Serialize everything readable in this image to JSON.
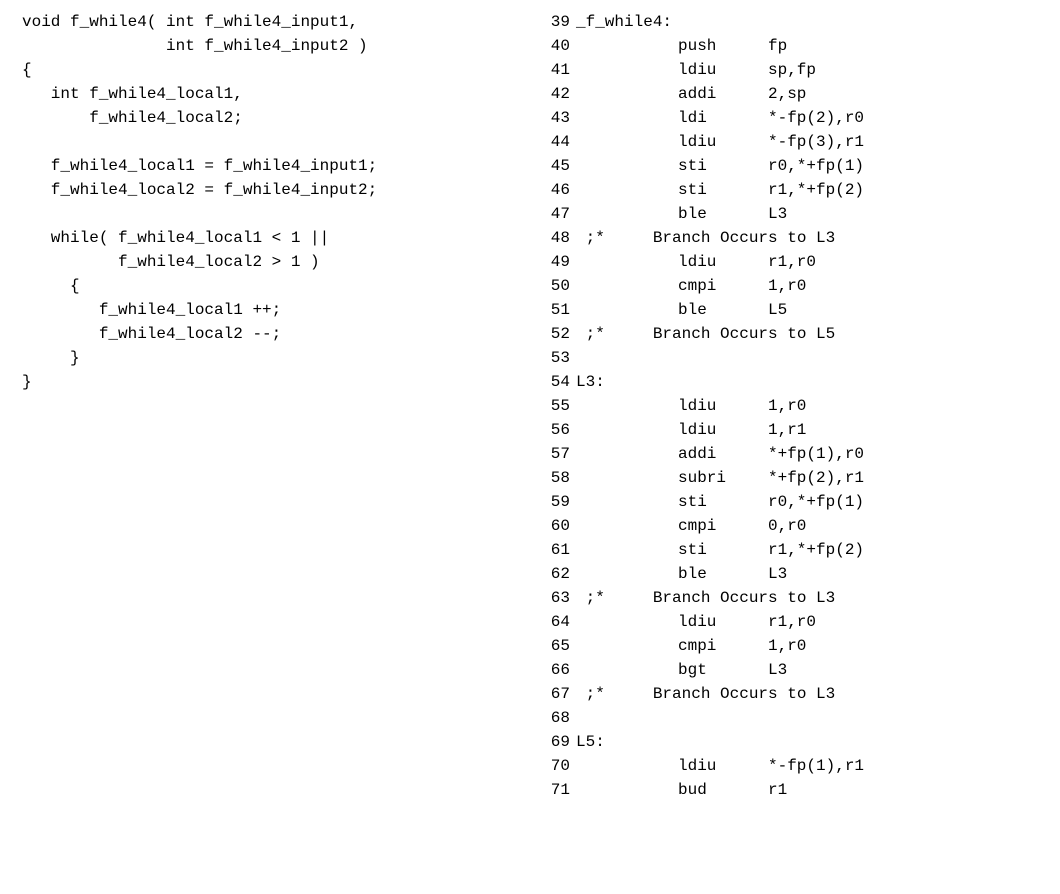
{
  "c_code": [
    "void f_while4( int f_while4_input1,",
    "               int f_while4_input2 )",
    "{",
    "   int f_while4_local1,",
    "       f_while4_local2;",
    "",
    "   f_while4_local1 = f_while4_input1;",
    "   f_while4_local2 = f_while4_input2;",
    "",
    "   while( f_while4_local1 < 1 ||",
    "          f_while4_local2 > 1 )",
    "     {",
    "        f_while4_local1 ++;",
    "        f_while4_local2 --;",
    "     }",
    "}"
  ],
  "asm": [
    {
      "n": "39",
      "label": "_f_while4:",
      "op": "",
      "arg": ""
    },
    {
      "n": "40",
      "label": "",
      "op": "push",
      "arg": "fp"
    },
    {
      "n": "41",
      "label": "",
      "op": "ldiu",
      "arg": "sp,fp"
    },
    {
      "n": "42",
      "label": "",
      "op": "addi",
      "arg": "2,sp"
    },
    {
      "n": "43",
      "label": "",
      "op": "ldi",
      "arg": "*-fp(2),r0"
    },
    {
      "n": "44",
      "label": "",
      "op": "ldiu",
      "arg": "*-fp(3),r1"
    },
    {
      "n": "45",
      "label": "",
      "op": "sti",
      "arg": "r0,*+fp(1)"
    },
    {
      "n": "46",
      "label": "",
      "op": "sti",
      "arg": "r1,*+fp(2)"
    },
    {
      "n": "47",
      "label": "",
      "op": "ble",
      "arg": "L3"
    },
    {
      "n": "48",
      "comment": ";*     Branch Occurs to L3"
    },
    {
      "n": "49",
      "label": "",
      "op": "ldiu",
      "arg": "r1,r0"
    },
    {
      "n": "50",
      "label": "",
      "op": "cmpi",
      "arg": "1,r0"
    },
    {
      "n": "51",
      "label": "",
      "op": "ble",
      "arg": "L5"
    },
    {
      "n": "52",
      "comment": ";*     Branch Occurs to L5"
    },
    {
      "n": "53",
      "label": "",
      "op": "",
      "arg": ""
    },
    {
      "n": "54",
      "label": "L3:",
      "op": "",
      "arg": ""
    },
    {
      "n": "55",
      "label": "",
      "op": "ldiu",
      "arg": "1,r0"
    },
    {
      "n": "56",
      "label": "",
      "op": "ldiu",
      "arg": "1,r1"
    },
    {
      "n": "57",
      "label": "",
      "op": "addi",
      "arg": "*+fp(1),r0"
    },
    {
      "n": "58",
      "label": "",
      "op": "subri",
      "arg": "*+fp(2),r1"
    },
    {
      "n": "59",
      "label": "",
      "op": "sti",
      "arg": "r0,*+fp(1)"
    },
    {
      "n": "60",
      "label": "",
      "op": "cmpi",
      "arg": "0,r0"
    },
    {
      "n": "61",
      "label": "",
      "op": "sti",
      "arg": "r1,*+fp(2)"
    },
    {
      "n": "62",
      "label": "",
      "op": "ble",
      "arg": "L3"
    },
    {
      "n": "63",
      "comment": ";*     Branch Occurs to L3"
    },
    {
      "n": "64",
      "label": "",
      "op": "ldiu",
      "arg": "r1,r0"
    },
    {
      "n": "65",
      "label": "",
      "op": "cmpi",
      "arg": "1,r0"
    },
    {
      "n": "66",
      "label": "",
      "op": "bgt",
      "arg": "L3"
    },
    {
      "n": "67",
      "comment": ";*     Branch Occurs to L3"
    },
    {
      "n": "68",
      "label": "",
      "op": "",
      "arg": ""
    },
    {
      "n": "69",
      "label": "L5:",
      "op": "",
      "arg": ""
    },
    {
      "n": "70",
      "label": "",
      "op": "ldiu",
      "arg": "*-fp(1),r1"
    },
    {
      "n": "71",
      "label": "",
      "op": "bud",
      "arg": "r1"
    }
  ]
}
